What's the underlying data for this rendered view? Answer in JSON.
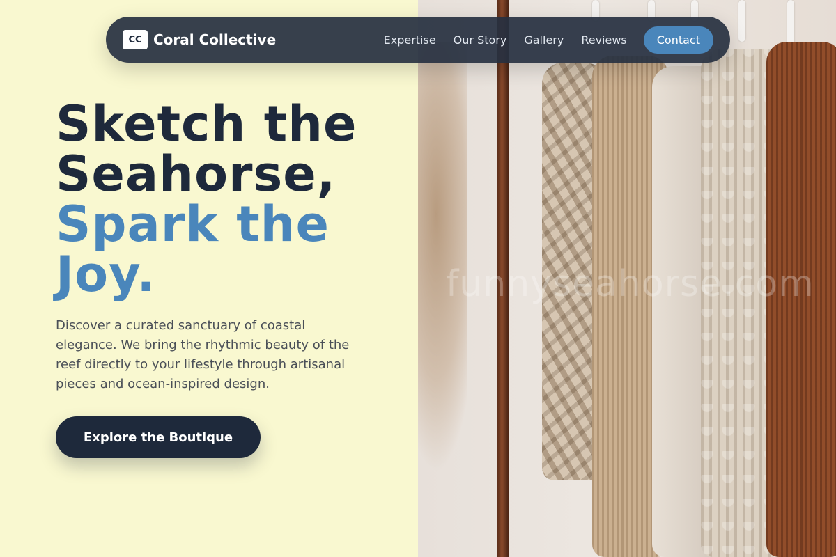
{
  "nav": {
    "logo_text": "CC",
    "brand_name": "Coral Collective",
    "links": [
      "Expertise",
      "Our Story",
      "Gallery",
      "Reviews"
    ],
    "cta_label": "Contact"
  },
  "hero": {
    "title_line1": "Sketch the",
    "title_line2": "Seahorse,",
    "title_accent_line1": "Spark the",
    "title_accent_line2": "Joy.",
    "description": "Discover a curated sanctuary of coastal elegance. We bring the rhythmic beauty of the reef directly to your lifestyle through artisanal pieces and ocean-inspired design.",
    "cta_label": "Explore the Boutique"
  },
  "image": {
    "watermark": "funnyseahorse.com"
  },
  "colors": {
    "background": "#f9f8d0",
    "navy": "#1e293b",
    "accent_blue": "#4a86bb",
    "nav_bg": "#263040"
  }
}
